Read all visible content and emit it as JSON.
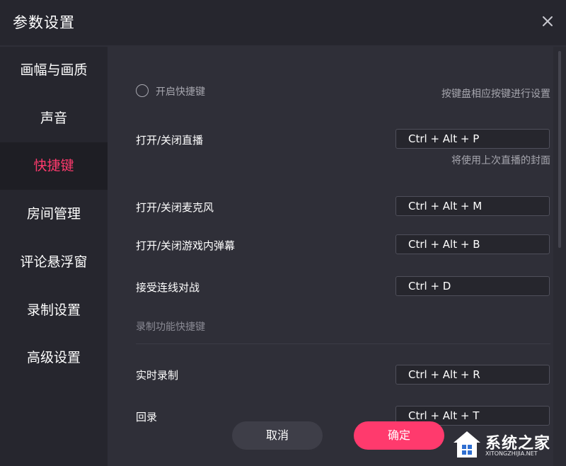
{
  "window": {
    "title": "参数设置"
  },
  "sidebar": {
    "items": [
      {
        "label": "画幅与画质",
        "active": false
      },
      {
        "label": "声音",
        "active": false
      },
      {
        "label": "快捷键",
        "active": true
      },
      {
        "label": "房间管理",
        "active": false
      },
      {
        "label": "评论悬浮窗",
        "active": false
      },
      {
        "label": "录制设置",
        "active": false
      },
      {
        "label": "高级设置",
        "active": false
      }
    ]
  },
  "shortcuts": {
    "enable_label": "开启快捷键",
    "enable_checked": false,
    "enable_hint": "按键盘相应按键进行设置",
    "rows": [
      {
        "label": "打开/关闭直播",
        "value": "Ctrl + Alt + P",
        "hint": "将使用上次直播的封面"
      },
      {
        "label": "打开/关闭麦克风",
        "value": "Ctrl + Alt + M"
      },
      {
        "label": "打开/关闭游戏内弹幕",
        "value": "Ctrl + Alt + B"
      },
      {
        "label": "接受连线对战",
        "value": "Ctrl + D"
      }
    ],
    "record_section_label": "录制功能快捷键",
    "record_rows": [
      {
        "label": "实时录制",
        "value": "Ctrl + Alt + R"
      },
      {
        "label": "回录",
        "value": "Ctrl + Alt + T"
      }
    ]
  },
  "footer": {
    "cancel_label": "取消",
    "ok_label": "确定"
  },
  "watermark": {
    "text": "系统之家",
    "sub": "XITONGZHIJIA.NET"
  },
  "colors": {
    "accent": "#ff3a6d",
    "background": "#2f2f38",
    "sidebar": "#26262e",
    "sidebar_active": "#1e1e24"
  },
  "icons": {
    "close": "close-icon",
    "radio": "radio-unchecked-icon",
    "logo": "house-logo-icon"
  }
}
